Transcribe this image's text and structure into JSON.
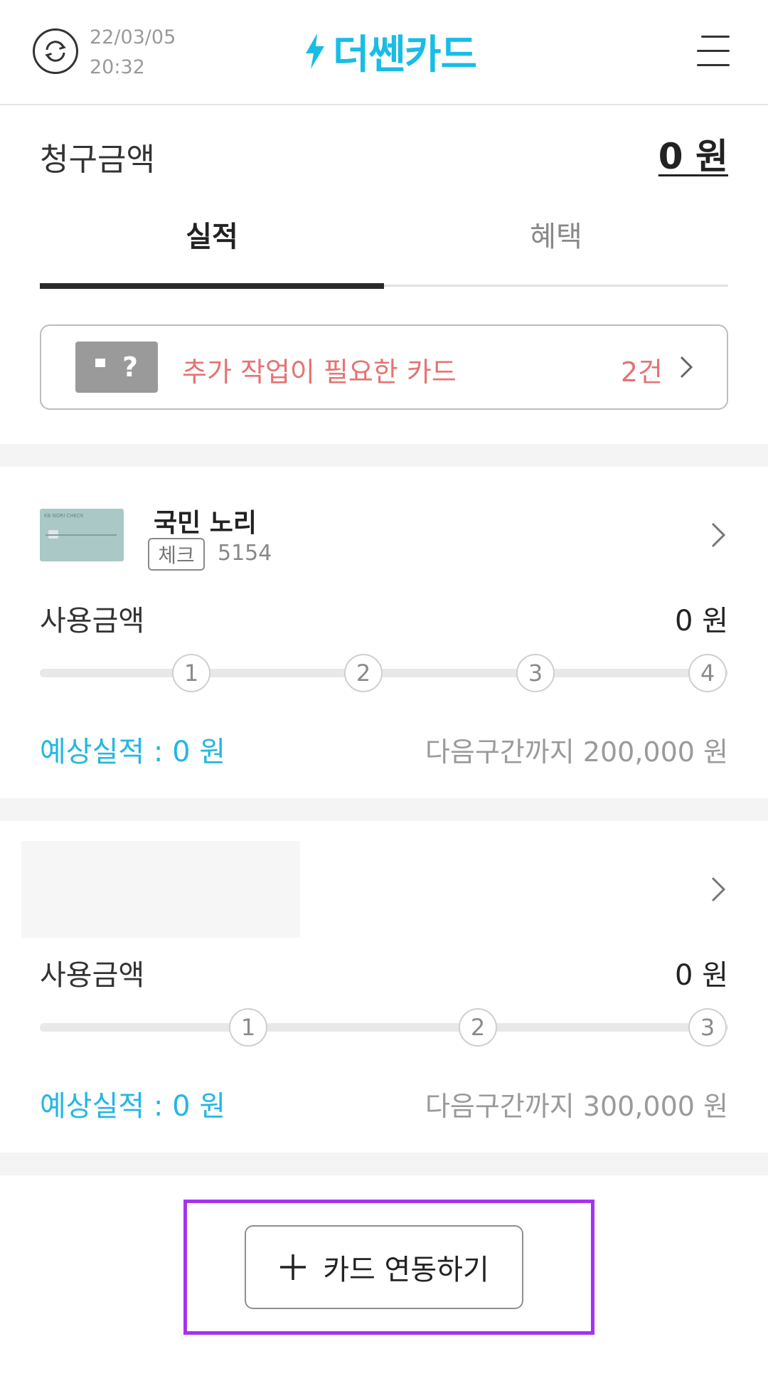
{
  "header": {
    "date": "22/03/05",
    "time": "20:32",
    "logo_text": "더쎈카드",
    "brand_color": "#18bde6"
  },
  "billing": {
    "label": "청구금액",
    "amount": "0 원"
  },
  "tabs": [
    {
      "label": "실적",
      "active": true
    },
    {
      "label": "혜택",
      "active": false
    }
  ],
  "notice": {
    "text": "추가 작업이 필요한 카드",
    "count": "2건",
    "color": "#e57373"
  },
  "cards": [
    {
      "name": "국민 노리",
      "type_badge": "체크",
      "number_suffix": "5154",
      "usage_label": "사용금액",
      "usage_amount": "0 원",
      "steps": [
        "1",
        "2",
        "3",
        "4"
      ],
      "expected": "예상실적 : 0 원",
      "next_tier": "다음구간까지 200,000 원"
    },
    {
      "usage_label": "사용금액",
      "usage_amount": "0 원",
      "steps": [
        "1",
        "2",
        "3"
      ],
      "expected": "예상실적 : 0 원",
      "next_tier": "다음구간까지 300,000 원"
    }
  ],
  "add_card": {
    "label": "카드 연동하기"
  }
}
